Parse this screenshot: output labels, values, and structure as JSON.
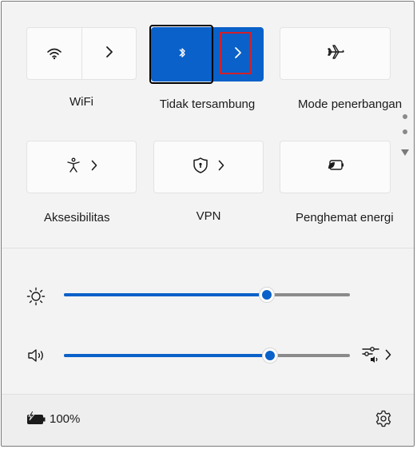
{
  "quick_settings": {
    "tiles": [
      {
        "label": "WiFi",
        "icon": "wifi-icon",
        "active": false,
        "has_expand": true
      },
      {
        "label": "Tidak tersambung",
        "icon": "bluetooth-icon",
        "active": true,
        "has_expand": true
      },
      {
        "label": "Mode penerbangan",
        "icon": "airplane-icon",
        "active": false,
        "has_expand": false
      },
      {
        "label": "Aksesibilitas",
        "icon": "accessibility-icon",
        "active": false,
        "has_expand": true
      },
      {
        "label": "VPN",
        "icon": "vpn-shield-icon",
        "active": false,
        "has_expand": true
      },
      {
        "label": "Penghemat energi",
        "icon": "energy-saver-icon",
        "active": false,
        "has_expand": false
      }
    ],
    "brightness": {
      "icon": "brightness-icon",
      "level": 0.71
    },
    "volume": {
      "icon": "speaker-icon",
      "level": 0.72,
      "mixer_icon": "audio-mixer-icon"
    },
    "battery": {
      "icon": "battery-charging-icon",
      "percent": "100%"
    },
    "settings_icon": "gear-icon",
    "colors": {
      "accent": "#0a61c9",
      "highlight": "#d0202a"
    }
  }
}
